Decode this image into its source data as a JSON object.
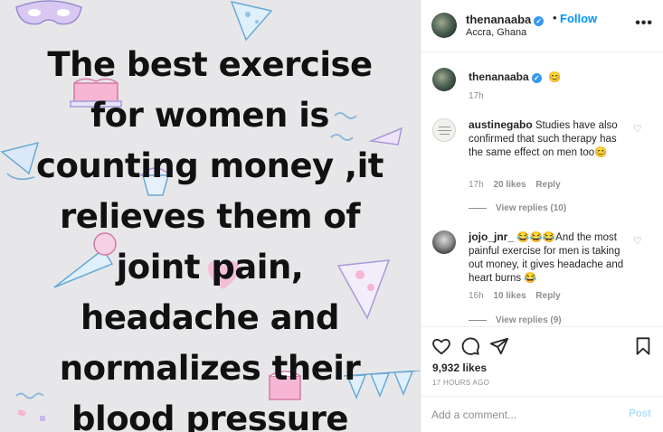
{
  "post": {
    "image_text_lines": [
      "The best exercise",
      "for women is",
      "counting money ,it",
      "relieves them of",
      "joint pain,",
      "headache and",
      "normalizes their",
      "blood pressure"
    ]
  },
  "header": {
    "username": "thenanaaba",
    "separator": "•",
    "follow_label": "Follow",
    "location": "Accra, Ghana",
    "more_icon": "more-horizontal-icon"
  },
  "caption": {
    "username": "thenanaaba",
    "text": "😊",
    "time": "17h"
  },
  "comments": [
    {
      "username": "austinegabo",
      "text": "Studies have also confirmed that such therapy has the same effect on men too😊",
      "time": "17h",
      "likes": "20 likes",
      "reply_label": "Reply",
      "view_replies": "View replies (10)"
    },
    {
      "username": "jojo_jnr_",
      "text": "😂😂😂And the most painful exercise for men is taking out money, it gives headache and heart burns 😂",
      "time": "16h",
      "likes": "10 likes",
      "reply_label": "Reply",
      "view_replies": "View replies (9)"
    }
  ],
  "actions": {
    "icons": [
      "heart-icon",
      "comment-icon",
      "share-icon",
      "bookmark-icon"
    ],
    "likes": "9,932 likes",
    "time_ago": "17 HOURS AGO"
  },
  "add_comment": {
    "placeholder": "Add a comment...",
    "post_label": "Post"
  },
  "colors": {
    "link_blue": "#0095f6",
    "post_disabled": "#b2dffc",
    "muted": "#8e8e8e",
    "media_bg": "#e7e7e9"
  }
}
